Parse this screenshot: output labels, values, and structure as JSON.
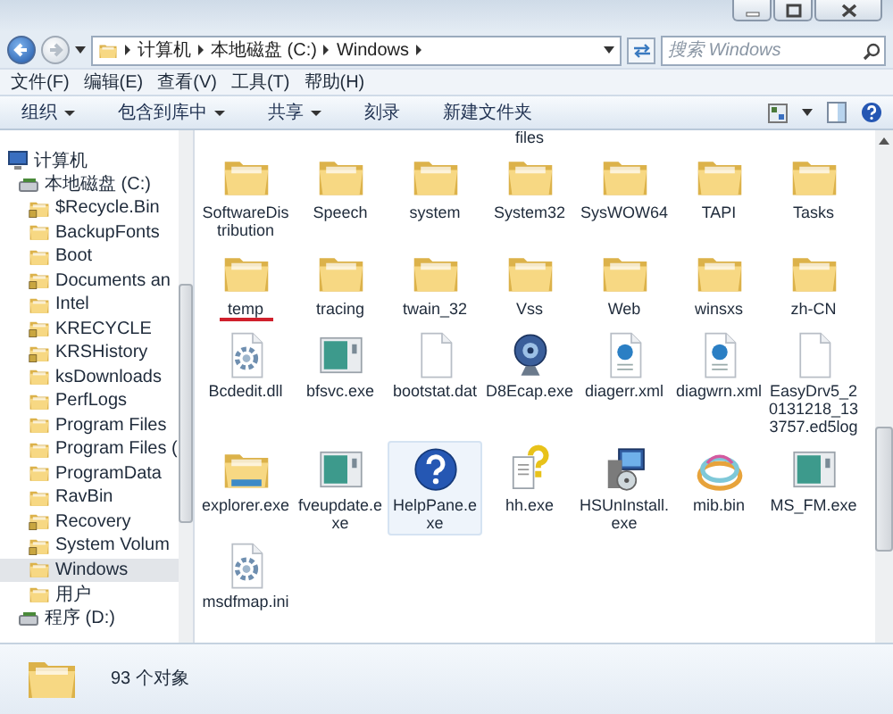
{
  "address_bar": {
    "breadcrumbs": [
      "计算机",
      "本地磁盘 (C:)",
      "Windows"
    ]
  },
  "search": {
    "placeholder": "搜索 Windows"
  },
  "menu": [
    "文件(F)",
    "编辑(E)",
    "查看(V)",
    "工具(T)",
    "帮助(H)"
  ],
  "toolbar": [
    {
      "label": "组织",
      "dropdown": true
    },
    {
      "label": "包含到库中",
      "dropdown": true
    },
    {
      "label": "共享",
      "dropdown": true
    },
    {
      "label": "刻录",
      "dropdown": false
    },
    {
      "label": "新建文件夹",
      "dropdown": false
    }
  ],
  "sidebar": {
    "items": [
      {
        "label": "计算机",
        "kind": "computer",
        "selected": false,
        "children": [
          {
            "label": "本地磁盘 (C:)",
            "kind": "drive",
            "selected": false,
            "children": [
              {
                "label": "$Recycle.Bin",
                "kind": "locked-folder",
                "selected": false
              },
              {
                "label": "BackupFonts",
                "kind": "folder",
                "selected": false
              },
              {
                "label": "Boot",
                "kind": "folder",
                "selected": false
              },
              {
                "label": "Documents an",
                "kind": "locked-folder",
                "selected": false
              },
              {
                "label": "Intel",
                "kind": "folder",
                "selected": false
              },
              {
                "label": "KRECYCLE",
                "kind": "locked-folder",
                "selected": false
              },
              {
                "label": "KRSHistory",
                "kind": "locked-folder",
                "selected": false
              },
              {
                "label": "ksDownloads",
                "kind": "folder",
                "selected": false
              },
              {
                "label": "PerfLogs",
                "kind": "folder",
                "selected": false
              },
              {
                "label": "Program Files",
                "kind": "folder",
                "selected": false
              },
              {
                "label": "Program Files (",
                "kind": "folder",
                "selected": false
              },
              {
                "label": "ProgramData",
                "kind": "folder",
                "selected": false
              },
              {
                "label": "RavBin",
                "kind": "folder",
                "selected": false
              },
              {
                "label": "Recovery",
                "kind": "locked-folder",
                "selected": false
              },
              {
                "label": "System Volum",
                "kind": "locked-folder",
                "selected": false
              },
              {
                "label": "Windows",
                "kind": "folder",
                "selected": true
              },
              {
                "label": "用户",
                "kind": "folder",
                "selected": false
              }
            ]
          },
          {
            "label": "程序 (D:)",
            "kind": "drive",
            "selected": false
          }
        ]
      }
    ]
  },
  "files": {
    "partial_label": "files",
    "items": [
      {
        "name": "SoftwareDistribution",
        "kind": "folder",
        "selected": false,
        "underlined": false
      },
      {
        "name": "Speech",
        "kind": "folder",
        "selected": false,
        "underlined": false
      },
      {
        "name": "system",
        "kind": "folder",
        "selected": false,
        "underlined": false
      },
      {
        "name": "System32",
        "kind": "folder",
        "selected": false,
        "underlined": false
      },
      {
        "name": "SysWOW64",
        "kind": "folder",
        "selected": false,
        "underlined": false
      },
      {
        "name": "TAPI",
        "kind": "folder",
        "selected": false,
        "underlined": false
      },
      {
        "name": "Tasks",
        "kind": "folder",
        "selected": false,
        "underlined": false
      },
      {
        "name": "temp",
        "kind": "folder",
        "selected": false,
        "underlined": true
      },
      {
        "name": "tracing",
        "kind": "folder",
        "selected": false,
        "underlined": false
      },
      {
        "name": "twain_32",
        "kind": "folder",
        "selected": false,
        "underlined": false
      },
      {
        "name": "Vss",
        "kind": "folder",
        "selected": false,
        "underlined": false
      },
      {
        "name": "Web",
        "kind": "folder",
        "selected": false,
        "underlined": false
      },
      {
        "name": "winsxs",
        "kind": "folder",
        "selected": false,
        "underlined": false
      },
      {
        "name": "zh-CN",
        "kind": "folder",
        "selected": false,
        "underlined": false
      },
      {
        "name": "Bcdedit.dll",
        "kind": "settings-file",
        "selected": false,
        "underlined": false
      },
      {
        "name": "bfsvc.exe",
        "kind": "app",
        "selected": false,
        "underlined": false
      },
      {
        "name": "bootstat.dat",
        "kind": "blank-file",
        "selected": false,
        "underlined": false
      },
      {
        "name": "D8Ecap.exe",
        "kind": "webcam",
        "selected": false,
        "underlined": false
      },
      {
        "name": "diagerr.xml",
        "kind": "web-file",
        "selected": false,
        "underlined": false
      },
      {
        "name": "diagwrn.xml",
        "kind": "web-file",
        "selected": false,
        "underlined": false
      },
      {
        "name": "EasyDrv5_20131218_133757.ed5log",
        "kind": "blank-file",
        "selected": false,
        "underlined": false
      },
      {
        "name": "explorer.exe",
        "kind": "explorer",
        "selected": false,
        "underlined": false
      },
      {
        "name": "fveupdate.exe",
        "kind": "app",
        "selected": false,
        "underlined": false
      },
      {
        "name": "HelpPane.exe",
        "kind": "help",
        "selected": true,
        "underlined": false
      },
      {
        "name": "hh.exe",
        "kind": "help-file",
        "selected": false,
        "underlined": false
      },
      {
        "name": "HSUnInstall.exe",
        "kind": "installer",
        "selected": false,
        "underlined": false
      },
      {
        "name": "mib.bin",
        "kind": "swirl",
        "selected": false,
        "underlined": false
      },
      {
        "name": "MS_FM.exe",
        "kind": "app",
        "selected": false,
        "underlined": false
      },
      {
        "name": "msdfmap.ini",
        "kind": "settings-file",
        "selected": false,
        "underlined": false
      }
    ]
  },
  "status_bar": {
    "text": "93 个对象"
  }
}
